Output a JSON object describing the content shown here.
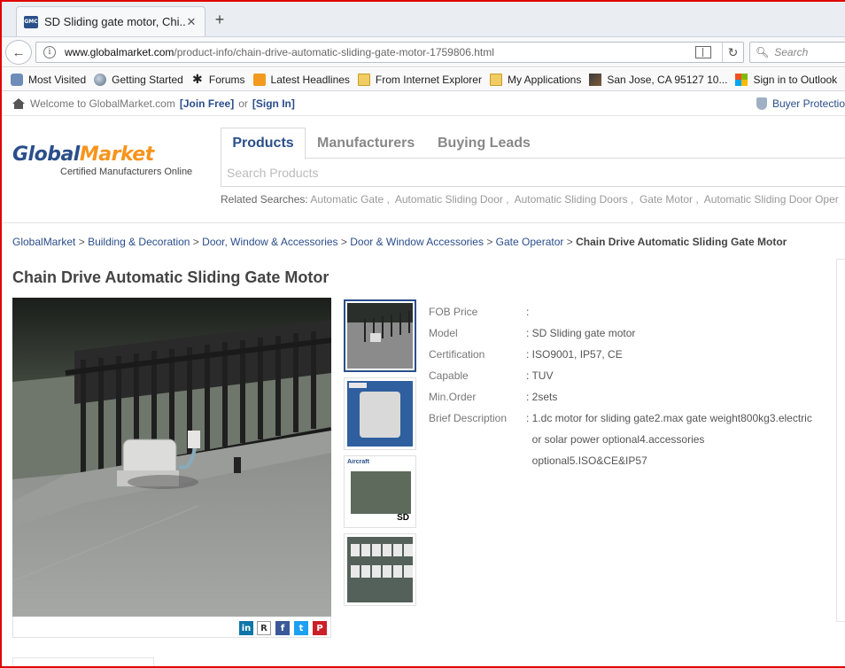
{
  "browser": {
    "tab_title": "SD Sliding gate motor, Chi...",
    "tab_favicon": "GMC",
    "new_tab": "+",
    "url_domain": "www.globalmarket.com",
    "url_path": "/product-info/chain-drive-automatic-sliding-gate-motor-1759806.html",
    "search_placeholder": "Search",
    "bookmarks": [
      {
        "label": "Most Visited",
        "icon": "gear-icon"
      },
      {
        "label": "Getting Started",
        "icon": "globe-icon"
      },
      {
        "label": "Forums",
        "icon": "asterisk-icon"
      },
      {
        "label": "Latest Headlines",
        "icon": "rss-icon"
      },
      {
        "label": "From Internet Explorer",
        "icon": "folder-icon"
      },
      {
        "label": "My Applications",
        "icon": "folder-icon"
      },
      {
        "label": "San Jose, CA 95127 10...",
        "icon": "map-icon"
      },
      {
        "label": "Sign in to Outlook",
        "icon": "microsoft-icon"
      }
    ]
  },
  "site": {
    "welcome": "Welcome to GlobalMarket.com",
    "join": "[Join Free]",
    "or": "or",
    "signin": "[Sign In]",
    "buyer_protection": "Buyer Protectio",
    "logo_global": "Global",
    "logo_market": "Market",
    "logo_tagline": "Certified Manufacturers Online",
    "tabs": [
      "Products",
      "Manufacturers",
      "Buying Leads"
    ],
    "search_placeholder": "Search Products",
    "related_label": "Related Searches:",
    "related": [
      "Automatic Gate",
      "Automatic Sliding Door",
      "Automatic Sliding Doors",
      "Gate Motor",
      "Automatic Sliding Door Oper"
    ]
  },
  "breadcrumb": [
    "GlobalMarket",
    "Building & Decoration",
    "Door, Window & Accessories",
    "Door & Window Accessories",
    "Gate Operator",
    "Chain Drive Automatic Sliding Gate Motor"
  ],
  "product": {
    "title": "Chain Drive Automatic Sliding Gate Motor",
    "thumbnail_sd_label": "SD",
    "thumbnail_brand": "Aircraft",
    "specs": [
      {
        "key": "FOB Price",
        "value": ":"
      },
      {
        "key": "Model",
        "value": ": SD Sliding gate motor"
      },
      {
        "key": "Certification",
        "value": ": ISO9001, IP57, CE"
      },
      {
        "key": "Capable",
        "value": ": TUV"
      },
      {
        "key": "Min.Order",
        "value": ": 2sets"
      },
      {
        "key": "Brief Description",
        "value": ": 1.dc motor for sliding gate2.max gate weight800kg3.electric"
      },
      {
        "key": "",
        "value": "  or solar power optional4.accessories"
      },
      {
        "key": "",
        "value": "  optional5.ISO&CE&IP57"
      }
    ],
    "share": [
      {
        "label": "in",
        "color": "#0e76a8",
        "icon": "linkedin-icon"
      },
      {
        "label": "R",
        "color": "#ffffff",
        "icon": "reddit-icon"
      },
      {
        "label": "f",
        "color": "#3b5998",
        "icon": "facebook-icon"
      },
      {
        "label": "t",
        "color": "#1da1f2",
        "icon": "twitter-icon"
      },
      {
        "label": "P",
        "color": "#cb2027",
        "icon": "pinterest-icon"
      }
    ]
  }
}
